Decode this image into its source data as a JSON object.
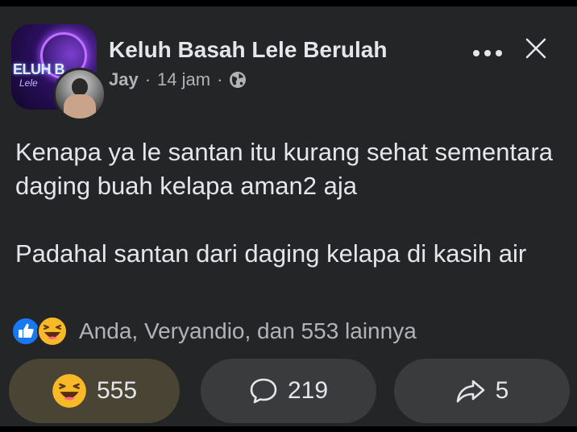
{
  "post": {
    "group_name": "Keluh Basah Lele Berulah",
    "group_logo_text": "ELUH B",
    "group_logo_subtext": "Lele",
    "author": "Jay",
    "separator": "·",
    "time": "14 jam",
    "audience_icon": "globe-icon",
    "paragraphs": [
      "Kenapa ya le santan itu kurang sehat sementara daging buah kelapa aman2 aja",
      "Padahal santan dari daging kelapa di kasih air"
    ]
  },
  "header_actions": {
    "more_icon": "more-dots-icon",
    "close_icon": "close-icon"
  },
  "reactions": {
    "icons": [
      "like-icon",
      "haha-icon"
    ],
    "summary": "Anda, Veryandio, dan 553 lainnya"
  },
  "actions": {
    "reaction_count": "555",
    "comment_count": "219",
    "share_count": "5"
  },
  "colors": {
    "background": "#242526",
    "text_primary": "#e4e6eb",
    "text_secondary": "#b0b3b8",
    "button_bg": "#3a3b3c",
    "reaction_button_bg": "#4a4434",
    "like_blue": "#1877f2",
    "haha_yellow": "#f7b928"
  }
}
